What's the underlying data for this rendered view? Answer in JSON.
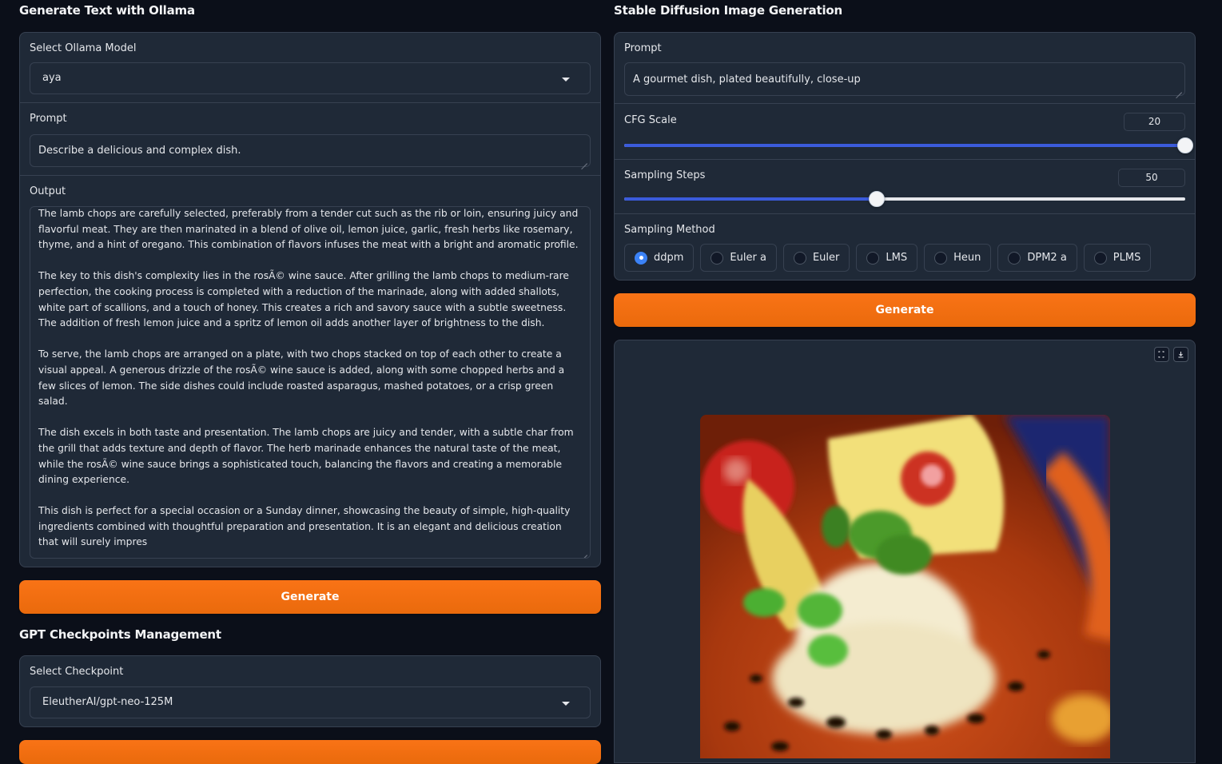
{
  "ollama": {
    "title": "Generate Text with Ollama",
    "model_label": "Select Ollama Model",
    "model_value": "aya",
    "prompt_label": "Prompt",
    "prompt_value": "Describe a delicious and complex dish.",
    "output_label": "Output",
    "output_paragraphs": [
      "The lamb chops are carefully selected, preferably from a tender cut such as the rib or loin, ensuring juicy and flavorful meat. They are then marinated in a blend of olive oil, lemon juice, garlic, fresh herbs like rosemary, thyme, and a hint of oregano. This combination of flavors infuses the meat with a bright and aromatic profile.",
      "The key to this dish's complexity lies in the rosÃ© wine sauce. After grilling the lamb chops to medium-rare perfection, the cooking process is completed with a reduction of the marinade, along with added shallots, white part of scallions, and a touch of honey. This creates a rich and savory sauce with a subtle sweetness. The addition of fresh lemon juice and a spritz of lemon oil adds another layer of brightness to the dish.",
      "To serve, the lamb chops are arranged on a plate, with two chops stacked on top of each other to create a visual appeal. A generous drizzle of the rosÃ© wine sauce is added, along with some chopped herbs and a few slices of lemon. The side dishes could include roasted asparagus, mashed potatoes, or a crisp green salad.",
      "The dish excels in both taste and presentation. The lamb chops are juicy and tender, with a subtle char from the grill that adds texture and depth of flavor. The herb marinade enhances the natural taste of the meat, while the rosÃ© wine sauce brings a sophisticated touch, balancing the flavors and creating a memorable dining experience.",
      "This dish is perfect for a special occasion or a Sunday dinner, showcasing the beauty of simple, high-quality ingredients combined with thoughtful preparation and presentation. It is an elegant and delicious creation that will surely impres"
    ],
    "generate_label": "Generate"
  },
  "checkpoints": {
    "title": "GPT Checkpoints Management",
    "select_label": "Select Checkpoint",
    "select_value": "EleutherAI/gpt-neo-125M"
  },
  "sd": {
    "title": "Stable Diffusion Image Generation",
    "prompt_label": "Prompt",
    "prompt_value": "A gourmet dish, plated beautifully, close-up",
    "cfg_label": "CFG Scale",
    "cfg_value": "20",
    "cfg_fraction": 1.0,
    "steps_label": "Sampling Steps",
    "steps_value": "50",
    "steps_fraction": 0.45,
    "method_label": "Sampling Method",
    "methods": [
      "ddpm",
      "Euler a",
      "Euler",
      "LMS",
      "Heun",
      "DPM2 a",
      "PLMS"
    ],
    "selected_method": "ddpm",
    "generate_label": "Generate"
  },
  "icons": {
    "dropdown": "chevron-down-icon",
    "fullscreen": "fullscreen-icon",
    "download": "download-icon"
  },
  "colors": {
    "accent": "#f97316",
    "slider": "#3b5bdb",
    "panel": "#1f2937",
    "background": "#0b0f19"
  }
}
